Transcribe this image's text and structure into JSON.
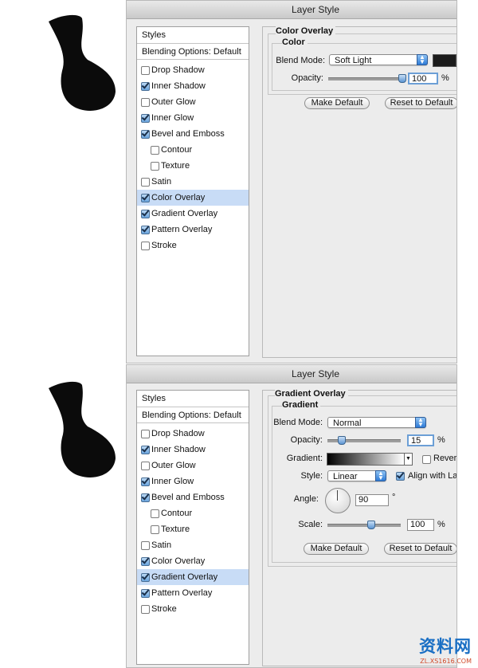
{
  "panel1": {
    "title": "Layer Style",
    "styles_header": "Styles",
    "blending_label": "Blending Options: Default",
    "items": [
      {
        "label": "Drop Shadow",
        "checked": false,
        "sub": false,
        "selected": false
      },
      {
        "label": "Inner Shadow",
        "checked": true,
        "sub": false,
        "selected": false
      },
      {
        "label": "Outer Glow",
        "checked": false,
        "sub": false,
        "selected": false
      },
      {
        "label": "Inner Glow",
        "checked": true,
        "sub": false,
        "selected": false
      },
      {
        "label": "Bevel and Emboss",
        "checked": true,
        "sub": false,
        "selected": false
      },
      {
        "label": "Contour",
        "checked": false,
        "sub": true,
        "selected": false
      },
      {
        "label": "Texture",
        "checked": false,
        "sub": true,
        "selected": false
      },
      {
        "label": "Satin",
        "checked": false,
        "sub": false,
        "selected": false
      },
      {
        "label": "Color Overlay",
        "checked": true,
        "sub": false,
        "selected": true
      },
      {
        "label": "Gradient Overlay",
        "checked": true,
        "sub": false,
        "selected": false
      },
      {
        "label": "Pattern Overlay",
        "checked": true,
        "sub": false,
        "selected": false
      },
      {
        "label": "Stroke",
        "checked": false,
        "sub": false,
        "selected": false
      }
    ],
    "section_title": "Color Overlay",
    "group_title": "Color",
    "blend_mode_label": "Blend Mode:",
    "blend_mode_value": "Soft Light",
    "overlay_color": "#1c1c1c",
    "opacity_label": "Opacity:",
    "opacity_value": "100",
    "opacity_unit": "%",
    "opacity_level": 1.0,
    "make_default": "Make Default",
    "reset_default": "Reset to Default"
  },
  "panel2": {
    "title": "Layer Style",
    "styles_header": "Styles",
    "blending_label": "Blending Options: Default",
    "items": [
      {
        "label": "Drop Shadow",
        "checked": false,
        "sub": false,
        "selected": false
      },
      {
        "label": "Inner Shadow",
        "checked": true,
        "sub": false,
        "selected": false
      },
      {
        "label": "Outer Glow",
        "checked": false,
        "sub": false,
        "selected": false
      },
      {
        "label": "Inner Glow",
        "checked": true,
        "sub": false,
        "selected": false
      },
      {
        "label": "Bevel and Emboss",
        "checked": true,
        "sub": false,
        "selected": false
      },
      {
        "label": "Contour",
        "checked": false,
        "sub": true,
        "selected": false
      },
      {
        "label": "Texture",
        "checked": false,
        "sub": true,
        "selected": false
      },
      {
        "label": "Satin",
        "checked": false,
        "sub": false,
        "selected": false
      },
      {
        "label": "Color Overlay",
        "checked": true,
        "sub": false,
        "selected": false
      },
      {
        "label": "Gradient Overlay",
        "checked": true,
        "sub": false,
        "selected": true
      },
      {
        "label": "Pattern Overlay",
        "checked": true,
        "sub": false,
        "selected": false
      },
      {
        "label": "Stroke",
        "checked": false,
        "sub": false,
        "selected": false
      }
    ],
    "section_title": "Gradient Overlay",
    "group_title": "Gradient",
    "blend_mode_label": "Blend Mode:",
    "blend_mode_value": "Normal",
    "opacity_label": "Opacity:",
    "opacity_value": "15",
    "opacity_unit": "%",
    "opacity_level": 0.15,
    "gradient_label": "Gradient:",
    "reverse_label": "Revers",
    "style_label": "Style:",
    "style_value": "Linear",
    "align_label": "Align with La",
    "angle_label": "Angle:",
    "angle_value": "90",
    "angle_unit": "°",
    "scale_label": "Scale:",
    "scale_value": "100",
    "scale_unit": "%",
    "scale_level": 0.6,
    "make_default": "Make Default",
    "reset_default": "Reset to Default"
  },
  "watermark": {
    "main": "资料网",
    "sub": "ZL.XS1616.COM"
  }
}
